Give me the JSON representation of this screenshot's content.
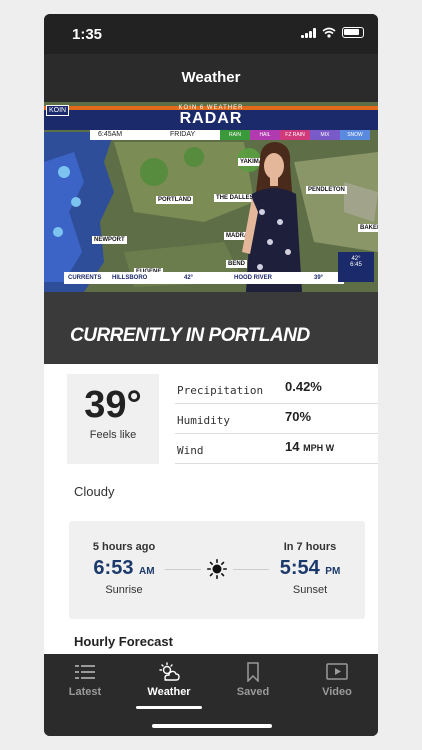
{
  "status_bar": {
    "time": "1:35"
  },
  "header": {
    "title": "Weather"
  },
  "video": {
    "logo": "KOIN",
    "banner_small": "KOIN 6 WEATHER",
    "banner_title": "RADAR",
    "time": "6:45AM",
    "day": "FRIDAY",
    "legend": [
      "RAIN",
      "HAIL",
      "FZ RAIN",
      "MIX",
      "SNOW"
    ],
    "cities": [
      "YAKIMA",
      "PORTLAND",
      "THE DALLES",
      "PENDLETON",
      "NEWPORT",
      "MADRAS",
      "EUGENE",
      "BAKER",
      "BEND"
    ],
    "ticker_label": "CURRENTS",
    "ticker_city1": "HILLSBORO",
    "ticker_temp1": "42°",
    "ticker_city2": "HOOD RIVER",
    "ticker_temp2": "39°",
    "corner_temp": "42°",
    "corner_time": "6:45"
  },
  "current": {
    "title": "CURRENTLY IN PORTLAND",
    "temperature": "39°",
    "feels_like_label": "Feels like",
    "stats": [
      {
        "label": "Precipitation",
        "value": "0.42%",
        "unit": ""
      },
      {
        "label": "Humidity",
        "value": "70%",
        "unit": ""
      },
      {
        "label": "Wind",
        "value": "14",
        "unit": "MPH W"
      }
    ],
    "condition": "Cloudy"
  },
  "sun": {
    "sunrise": {
      "ago": "5 hours ago",
      "time": "6:53",
      "ampm": "AM",
      "label": "Sunrise"
    },
    "sunset": {
      "ago": "In 7 hours",
      "time": "5:54",
      "ampm": "PM",
      "label": "Sunset"
    }
  },
  "hourly": {
    "title": "Hourly Forecast"
  },
  "tabs": [
    {
      "label": "Latest",
      "icon": "list-icon",
      "active": false
    },
    {
      "label": "Weather",
      "icon": "weather-icon",
      "active": true
    },
    {
      "label": "Saved",
      "icon": "bookmark-icon",
      "active": false
    },
    {
      "label": "Video",
      "icon": "play-icon",
      "active": false
    }
  ],
  "colors": {
    "accent_blue": "#1b3a6b",
    "tab_bg": "#2b2b2b",
    "banner_blue": "#1b2a6b",
    "banner_orange": "#e26a1b"
  }
}
